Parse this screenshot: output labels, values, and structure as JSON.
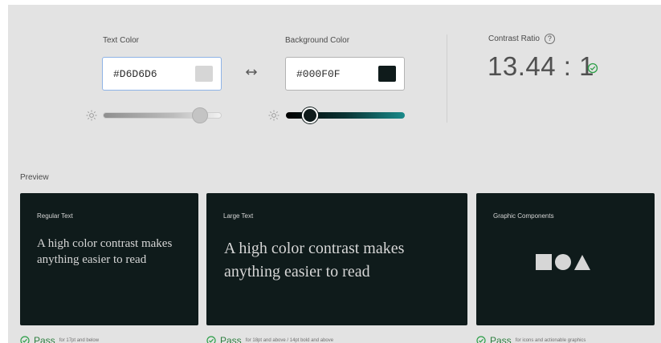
{
  "text_color": {
    "label": "Text Color",
    "hex": "#D6D6D6",
    "swatch_color": "#d6d6d6",
    "brightness": 0.82
  },
  "background_color": {
    "label": "Background Color",
    "hex": "#000F0F",
    "swatch_color": "#0f1b1b",
    "brightness": 0.2
  },
  "contrast": {
    "label": "Contrast Ratio",
    "help_glyph": "?",
    "value": "13.44 : 1",
    "status_color": "#2d9f48"
  },
  "preview": {
    "label": "Preview",
    "card_bg": "#0f1b1b",
    "text_fg": "#d6d6d6",
    "cards": [
      {
        "title": "Regular Text",
        "body": "A high color contrast makes anything easier to read"
      },
      {
        "title": "Large Text",
        "body": "A high color contrast makes anything easier to read"
      },
      {
        "title": "Graphic Components",
        "shapes": [
          "square",
          "circle",
          "triangle"
        ]
      }
    ]
  },
  "results": [
    {
      "word": "Pass",
      "note": "for 17pt and below"
    },
    {
      "word": "Pass",
      "note": "for 18pt and above / 14pt bold and above"
    },
    {
      "word": "Pass",
      "note": "for icons and actionable graphics"
    }
  ]
}
